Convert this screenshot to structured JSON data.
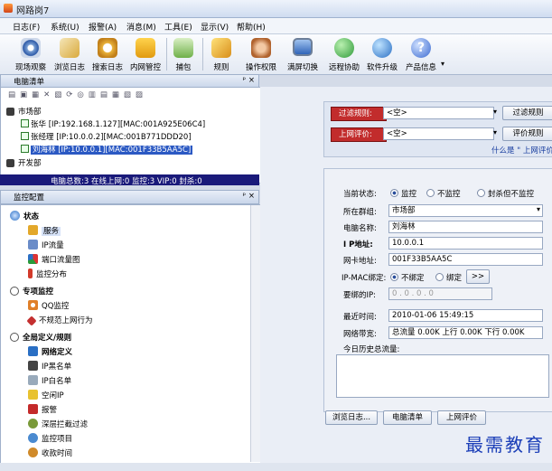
{
  "window": {
    "title": "网路岗7"
  },
  "menu": [
    "日志(F)",
    "系统(U)",
    "报警(A)",
    "消息(M)",
    "工具(E)",
    "显示(V)",
    "帮助(H)"
  ],
  "toolbar": [
    "现场观察",
    "浏览日志",
    "搜索日志",
    "内网管控",
    "捕包",
    "规则",
    "操作权限",
    "满屏切换",
    "远程协助",
    "软件升级",
    "产品信息"
  ],
  "computer_panel": {
    "title": "电脑清单",
    "controls": "ᵖ ×",
    "dept1": "市场部",
    "pcs": [
      "张华 [IP:192.168.1.127][MAC:001A925E06C4]",
      "张经理 [IP:10.0.0.2][MAC:001B771DDD20]",
      "刘海林 [IP:10.0.0.1][MAC:001F33B5AA5C]"
    ],
    "dept2": "开发部",
    "status": "电脑总数:3 在线上网:0 监控:3 VIP:0 封杀:0"
  },
  "monitor_panel": {
    "title": "监控配置",
    "controls": "ᵖ ×",
    "groups": [
      {
        "label": "状态",
        "items": [
          "服务",
          "IP流量",
          "端口流量图",
          "监控分布"
        ]
      },
      {
        "label": "专项监控",
        "items": [
          "QQ监控",
          "不规范上网行为"
        ]
      },
      {
        "label": "全局定义/规则",
        "items": [
          "网络定义",
          "IP黑名单",
          "IP白名单",
          "空闲IP",
          "报警",
          "深层拦截过滤",
          "监控项目",
          "收款时间"
        ]
      }
    ]
  },
  "filter": {
    "rule_label": "过滤规则:",
    "rule_value": "<空>",
    "rule_button": "过滤规则",
    "eval_label": "上网评价:",
    "eval_value": "<空>",
    "eval_button": "评价规则",
    "link": "什么是 \" 上网评价"
  },
  "detail": {
    "state_label": "当前状态:",
    "state_options": [
      "监控",
      "不监控",
      "封杀但不监控"
    ],
    "group_label": "所在群组:",
    "group_value": "市场部",
    "name_label": "电脑名称:",
    "name_value": "刘海林",
    "ip_label": "I P地址:",
    "ip_value": "10.0.0.1",
    "mac_label": "网卡地址:",
    "mac_value": "001F33B5AA5C",
    "bind_label": "IP-MAC绑定:",
    "bind_options": [
      "不绑定",
      "绑定"
    ],
    "bind_button": ">>",
    "bindip_label": "要绑的IP:",
    "bindip_value": "0 . 0 . 0 . 0",
    "time_label": "最近时间:",
    "time_value": "2010-01-06 15:49:15",
    "bw_label": "网络带宽:",
    "bw_value": "总流量 0.00K 上行 0.00K 下行 0.00K",
    "history_label": "今日历史总流量:"
  },
  "tabs": [
    "浏览日志...",
    "电脑清单",
    "上网评价"
  ],
  "watermark": "最需教育",
  "colors": {
    "accent_red": "#c22c2c",
    "status_bar": "#1a1a7a",
    "watermark": "#1c3fb8"
  }
}
